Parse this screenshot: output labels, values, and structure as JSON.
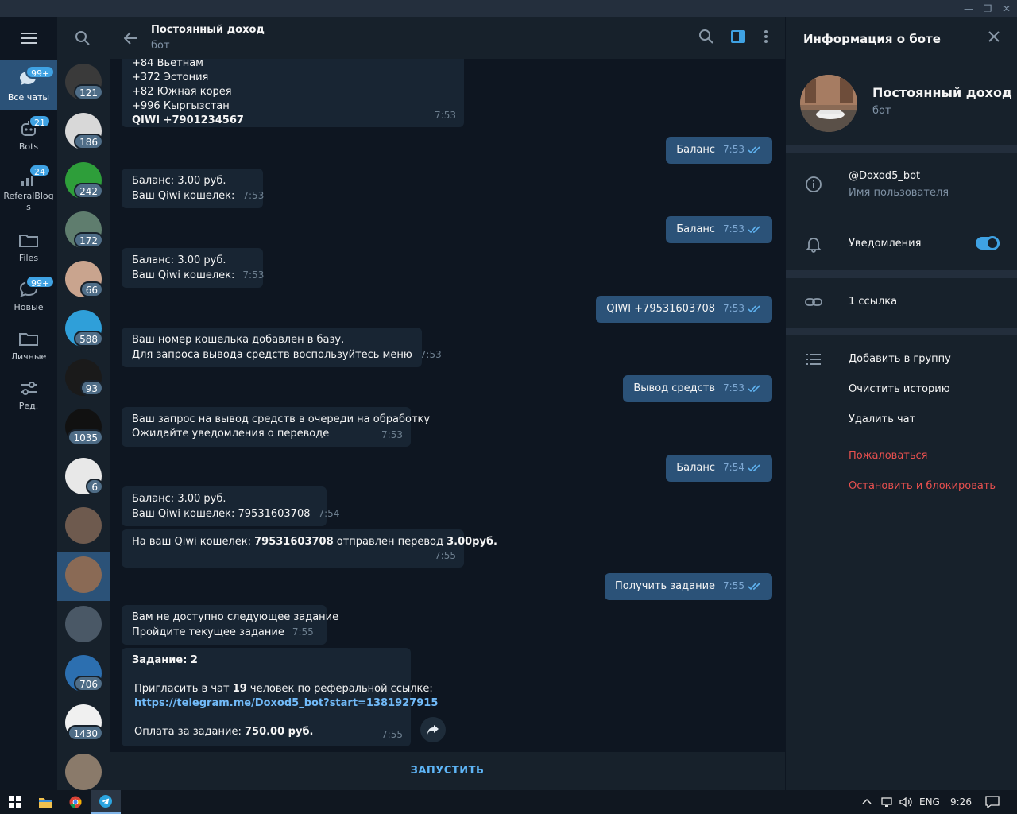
{
  "window": {
    "minimize": "—",
    "maximize": "❐",
    "close": "✕"
  },
  "folders": [
    {
      "label": "Все чаты",
      "badge": "99+"
    },
    {
      "label": "Bots",
      "badge": "21"
    },
    {
      "label": "ReferalBlogs",
      "badge": "24"
    },
    {
      "label": "Files",
      "badge": ""
    },
    {
      "label": "Новые",
      "badge": "99+"
    },
    {
      "label": "Личные",
      "badge": ""
    },
    {
      "label": "Ред.",
      "badge": ""
    }
  ],
  "chats": [
    {
      "unread": "121",
      "color": "#3a3a3a"
    },
    {
      "unread": "186",
      "color": "#d8d8d8"
    },
    {
      "unread": "242",
      "color": "#2e9e3a"
    },
    {
      "unread": "172",
      "color": "#5f7d6e"
    },
    {
      "unread": "66",
      "color": "#c9a48e"
    },
    {
      "unread": "588",
      "color": "#2f9fd9"
    },
    {
      "unread": "93",
      "color": "#1a1a1a"
    },
    {
      "unread": "1035",
      "color": "#111111"
    },
    {
      "unread": "6",
      "color": "#e8e8e8"
    },
    {
      "unread": "",
      "color": "#6e5a4e"
    },
    {
      "unread": "",
      "color": "#8a6a55"
    },
    {
      "unread": "",
      "color": "#4a5866"
    },
    {
      "unread": "706",
      "color": "#2c6fb0"
    },
    {
      "unread": "1430",
      "color": "#f0f0f0"
    },
    {
      "unread": "",
      "color": "#8a7a6a"
    }
  ],
  "header": {
    "title": "Постоянный доход",
    "subtitle": "бот"
  },
  "messages": {
    "m1": {
      "l0": "+84  Вьетнам",
      "l1": "+372  Эстония",
      "l2": "+82   Южная корея",
      "l3": "+996  Кыргызстан",
      "l4": "QIWI +7901234567",
      "time": "7:53"
    },
    "m2": {
      "text": "Баланс",
      "time": "7:53"
    },
    "m3": {
      "l1": "Баланс: 3.00 руб.",
      "l2": "Ваш Qiwi кошелек:",
      "time": "7:53"
    },
    "m4": {
      "text": "Баланс",
      "time": "7:53"
    },
    "m5": {
      "l1": "Баланс: 3.00 руб.",
      "l2": "Ваш Qiwi кошелек:",
      "time": "7:53"
    },
    "m6": {
      "text": "QIWI +79531603708",
      "time": "7:53"
    },
    "m7": {
      "l1": "Ваш номер кошелька добавлен в базу.",
      "l2": "Для запроса вывода средств воспользуйтесь меню",
      "time": "7:53"
    },
    "m8": {
      "text": "Вывод средств",
      "time": "7:53"
    },
    "m9": {
      "l1": "Ваш запрос на вывод средств в очереди на обработку",
      "l2": "Ожидайте уведомления о переводе",
      "time": "7:53"
    },
    "m10": {
      "text": "Баланс",
      "time": "7:54"
    },
    "m11": {
      "l1": "Баланс: 3.00 руб.",
      "l2": "Ваш Qiwi кошелек: 79531603708",
      "time": "7:54"
    },
    "m12": {
      "pre": "На ваш Qiwi кошелек: ",
      "wallet": "79531603708",
      "mid": " отправлен перевод ",
      "amount": "3.00руб.",
      "time": "7:55"
    },
    "m13": {
      "text": "Получить задание",
      "time": "7:55"
    },
    "m14": {
      "l1": "Вам не доступно следующее задание",
      "l2": "Пройдите текущее задание",
      "time": "7:55"
    },
    "m15": {
      "title": "Задание: 2",
      "pre": "Пригласить в чат ",
      "count": "19",
      "post": " человек по реферальной ссылке:",
      "link": "https://telegram.me/Doxod5_bot?start=1381927915",
      "pay_pre": "Оплата за задание: ",
      "pay": "750.00 руб.",
      "time": "7:55"
    }
  },
  "bottom": {
    "start": "ЗАПУСТИТЬ"
  },
  "info": {
    "title": "Информация о боте",
    "name": "Постоянный доход",
    "subtitle": "бот",
    "username": "@Doxod5_bot",
    "username_label": "Имя пользователя",
    "notifications": "Уведомления",
    "notifications_on": 1,
    "links": "1 ссылка",
    "add_group": "Добавить в группу",
    "clear_history": "Очистить историю",
    "delete_chat": "Удалить чат",
    "report": "Пожаловаться",
    "stop_block": "Остановить и блокировать"
  },
  "taskbar": {
    "lang": "ENG",
    "clock": "9:26"
  }
}
